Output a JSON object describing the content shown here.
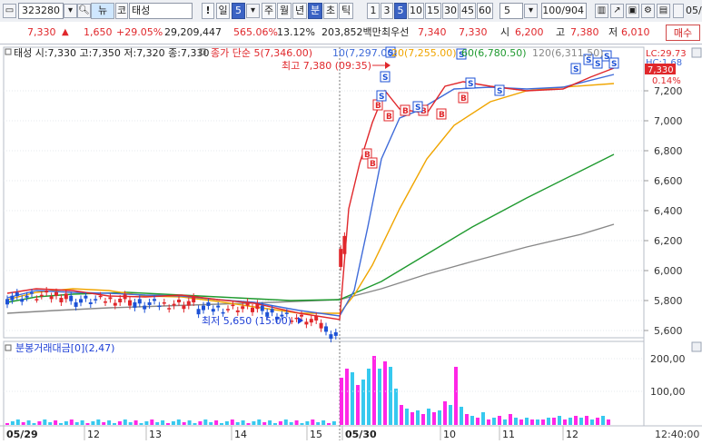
{
  "toolbar": {
    "code": "323280",
    "market_tag": "뉴",
    "market_type": "코",
    "stock_name": "태성",
    "exclaim": "!",
    "period_label": "일",
    "period_value": "5",
    "period_tabs": [
      "주",
      "월",
      "년",
      "분",
      "초",
      "틱"
    ],
    "interval_tabs": [
      "1",
      "3",
      "5",
      "10",
      "15",
      "30",
      "45",
      "60"
    ],
    "interval_selected": "5",
    "count_value": "5",
    "range_value": "100/904",
    "date_value": "05/"
  },
  "quote": {
    "price": "7,330",
    "arrow": "▲",
    "change": "1,650",
    "change_pct": "+29.05%",
    "volume": "29,209,447",
    "volume_ratio": "565.06%",
    "turnover": "13.12%",
    "amount": "203,852백만",
    "best_ask_label": "최우선",
    "best_ask": "7,340",
    "best_bid": "7,330",
    "open_label": "시",
    "open": "6,200",
    "high_label": "고",
    "high": "7,380",
    "low_label": "저",
    "low": "6,010",
    "buy_button": "매수"
  },
  "price_panel": {
    "header": "태성 시:7,330 고:7,350 저:7,320 종:7,330",
    "legend_close": "종가 단순 5(7,346.00)",
    "legend_ma10": "10(7,297.00)",
    "legend_ma20": "20(7,255.00)",
    "legend_ma60": "60(6,780.50)",
    "legend_ma120": "120(6,311.50)",
    "high_annotation": "최고 7,380 (09:35)",
    "low_annotation": "최저 5,650 (15:00)",
    "lc_label": "LC:29.73",
    "hc_label": "HC:1.68",
    "current_price_tag": "7,330",
    "pct_label": "0.14%",
    "y_ticks": [
      "7,200",
      "7,000",
      "6,800",
      "6,600",
      "6,400",
      "6,200",
      "6,000",
      "5,800",
      "5,600"
    ]
  },
  "volume_panel": {
    "header": "분봉거래대금[0](2,47)",
    "y_ticks": [
      "200,00",
      "100,00"
    ]
  },
  "x_axis": {
    "labels": [
      "05/29",
      "12",
      "13",
      "14",
      "15",
      "05/30",
      "10",
      "11",
      "12"
    ],
    "time": "12:40:00"
  },
  "colors": {
    "up": "#e0272b",
    "down": "#1d52d6",
    "ma5": "#e0272b",
    "ma10": "#3f6bd9",
    "ma20": "#f0a500",
    "ma60": "#1f9a2f",
    "ma120": "#888888",
    "vol_up": "#ff26e6",
    "vol_down": "#36c9ef"
  }
}
